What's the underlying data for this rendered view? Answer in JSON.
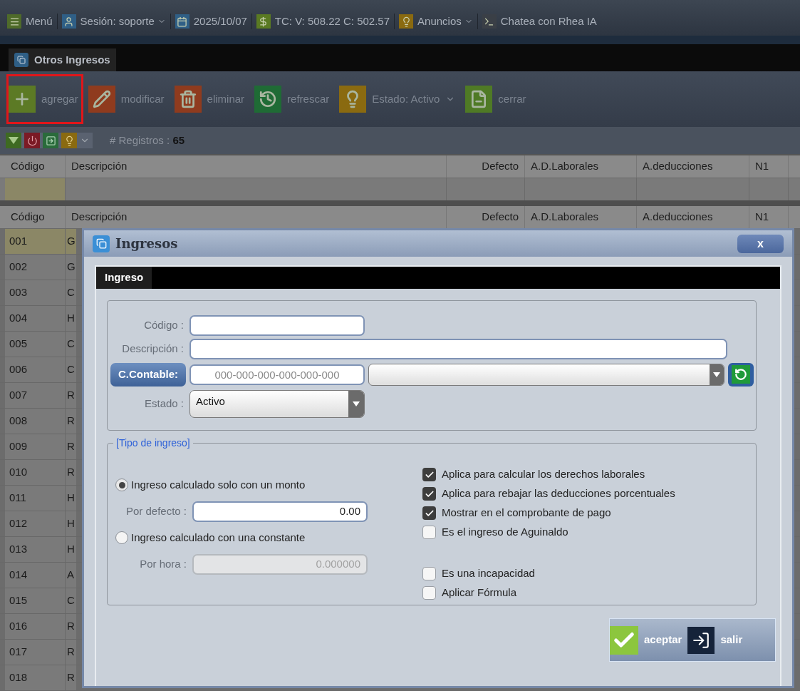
{
  "topbar": {
    "items": [
      {
        "kind": "menu",
        "label": "Menú",
        "dropdown": false
      },
      {
        "kind": "user",
        "label": "Sesión: soporte",
        "dropdown": true
      },
      {
        "kind": "calendar",
        "label": "2025/10/07",
        "dropdown": false
      },
      {
        "kind": "money",
        "label": "TC:  V: 508.22 C: 502.57",
        "dropdown": false
      },
      {
        "kind": "idea",
        "label": "Anuncios",
        "dropdown": true
      },
      {
        "kind": "chat",
        "label": "Chatea con Rhea IA",
        "dropdown": false
      }
    ]
  },
  "tab": {
    "label": "Otros Ingresos"
  },
  "toolbar": [
    {
      "kind": "add",
      "label": "agregar",
      "highlighted": true,
      "dropdown": false
    },
    {
      "kind": "edit",
      "label": "modificar",
      "highlighted": false,
      "dropdown": false
    },
    {
      "kind": "delete",
      "label": "eliminar",
      "highlighted": false,
      "dropdown": false
    },
    {
      "kind": "refresh",
      "label": "refrescar",
      "highlighted": false,
      "dropdown": false
    },
    {
      "kind": "idea",
      "label": "Estado: Activo",
      "highlighted": false,
      "dropdown": true
    },
    {
      "kind": "close",
      "label": "cerrar",
      "highlighted": false,
      "dropdown": false
    }
  ],
  "records": {
    "label": "# Registros :",
    "count": "65"
  },
  "filter_grid": {
    "columns": [
      "Código",
      "Descripción",
      "Defecto",
      "A.D.Laborales",
      "A.deducciones",
      "N1"
    ]
  },
  "grid": {
    "columns": [
      "Código",
      "Descripción",
      "Defecto",
      "A.D.Laborales",
      "A.deducciones",
      "N1"
    ],
    "rows": [
      {
        "code": "001",
        "description": "G",
        "selected": true
      },
      {
        "code": "002",
        "description": "G",
        "selected": false
      },
      {
        "code": "003",
        "description": "C",
        "selected": false
      },
      {
        "code": "004",
        "description": "H",
        "selected": false
      },
      {
        "code": "005",
        "description": "C",
        "selected": false
      },
      {
        "code": "006",
        "description": "C",
        "selected": false
      },
      {
        "code": "007",
        "description": "R",
        "selected": false
      },
      {
        "code": "008",
        "description": "R",
        "selected": false
      },
      {
        "code": "009",
        "description": "R",
        "selected": false
      },
      {
        "code": "010",
        "description": "R",
        "selected": false
      },
      {
        "code": "011",
        "description": "H",
        "selected": false
      },
      {
        "code": "012",
        "description": "H",
        "selected": false
      },
      {
        "code": "013",
        "description": "H",
        "selected": false
      },
      {
        "code": "014",
        "description": "A",
        "selected": false
      },
      {
        "code": "015",
        "description": "C",
        "selected": false
      },
      {
        "code": "016",
        "description": "R",
        "selected": false
      },
      {
        "code": "017",
        "description": "R",
        "selected": false
      },
      {
        "code": "018",
        "description": "R",
        "selected": false
      }
    ]
  },
  "dialog": {
    "title": "Ingresos",
    "close": "x",
    "section_tab": "Ingreso",
    "code": {
      "label": "Código :"
    },
    "description": {
      "label": "Descripción :"
    },
    "account": {
      "button": "C.Contable:",
      "placeholder": "000-000-000-000-000-000"
    },
    "status": {
      "label": "Estado :",
      "value": "Activo"
    },
    "type_group": {
      "legend": "[Tipo de ingreso]",
      "options": [
        {
          "label": "Ingreso calculado solo con un monto",
          "selected": true,
          "field_label": "Por defecto :",
          "value": "0.00",
          "disabled": false
        },
        {
          "label": "Ingreso calculado con una constante",
          "selected": false,
          "field_label": "Por hora :",
          "value": "0.000000",
          "disabled": true
        }
      ],
      "checks": [
        {
          "label": "Aplica para calcular los derechos laborales",
          "checked": true
        },
        {
          "label": "Aplica para rebajar las deducciones porcentuales",
          "checked": true
        },
        {
          "label": "Mostrar en el comprobante de pago",
          "checked": true
        },
        {
          "label": "Es el ingreso de Aguinaldo",
          "checked": false
        }
      ],
      "more_checks": [
        {
          "label": "Es una incapacidad",
          "checked": false
        },
        {
          "label": "Aplicar Fórmula",
          "checked": false
        }
      ]
    },
    "buttons": [
      {
        "kind": "accept",
        "label": "aceptar"
      },
      {
        "kind": "exit",
        "label": "salir"
      }
    ]
  }
}
